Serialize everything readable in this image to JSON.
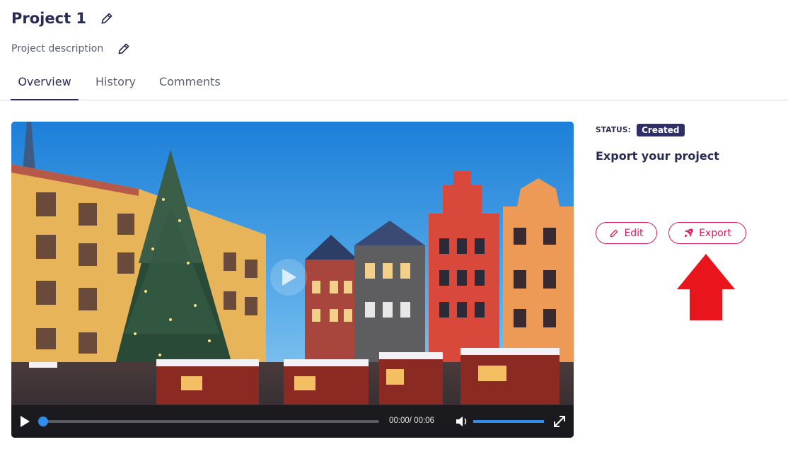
{
  "project": {
    "title": "Project 1",
    "description": "Project description"
  },
  "tabs": [
    {
      "label": "Overview",
      "active": true
    },
    {
      "label": "History",
      "active": false
    },
    {
      "label": "Comments",
      "active": false
    }
  ],
  "video": {
    "current_time": "00:00",
    "duration": "00:06",
    "time_text": "00:00/ 00:06",
    "progress": 0,
    "volume": 1.0
  },
  "sidebar": {
    "status_label": "STATUS:",
    "status_value": "Created",
    "heading": "Export your project",
    "edit_label": "Edit",
    "export_label": "Export"
  },
  "colors": {
    "brand_dark": "#282b55",
    "accent": "#d81b5a",
    "badge_bg": "#2d2f66",
    "player_blue": "#2e8ded",
    "annotation_arrow": "#e8151c"
  },
  "icons": {
    "title_edit": "pencil-icon",
    "desc_edit": "pencil-icon",
    "edit_button": "pencil-icon",
    "export_button": "rocket-icon",
    "play": "play-icon",
    "volume": "volume-icon",
    "fullscreen": "fullscreen-icon"
  }
}
